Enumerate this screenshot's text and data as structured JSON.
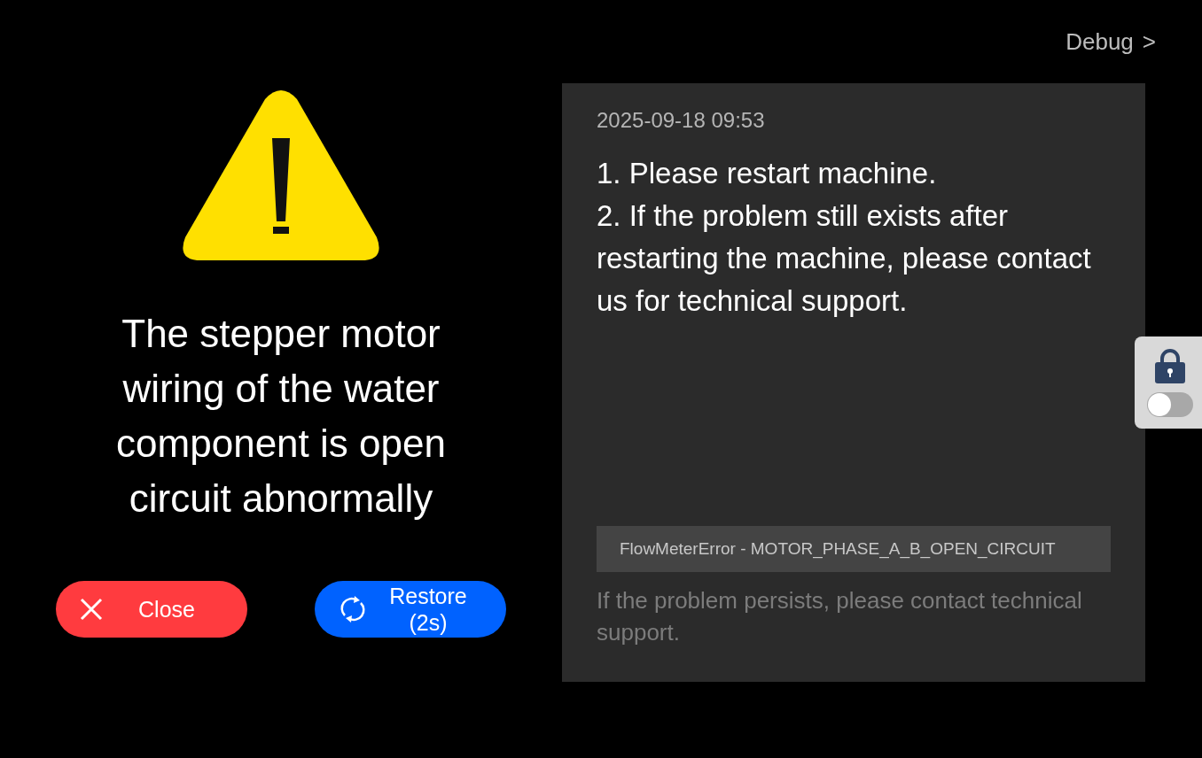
{
  "debug_link": {
    "label": "Debug",
    "chevron": ">"
  },
  "error": {
    "message": "The stepper motor wiring of the water component is open circuit abnormally"
  },
  "buttons": [
    {
      "kind": "close",
      "label": "Close"
    },
    {
      "kind": "restore",
      "label": "Restore",
      "sublabel": "(2s)"
    }
  ],
  "detail": {
    "timestamp": "2025-09-18 09:53",
    "steps": [
      "1. Please restart machine.",
      "2. If the problem still exists after restarting the machine, please contact us for technical support."
    ],
    "error_code": "FlowMeterError - MOTOR_PHASE_A_B_OPEN_CIRCUIT",
    "hint": "If the problem persists, please contact technical support."
  },
  "lock_panel": {
    "on": false
  }
}
